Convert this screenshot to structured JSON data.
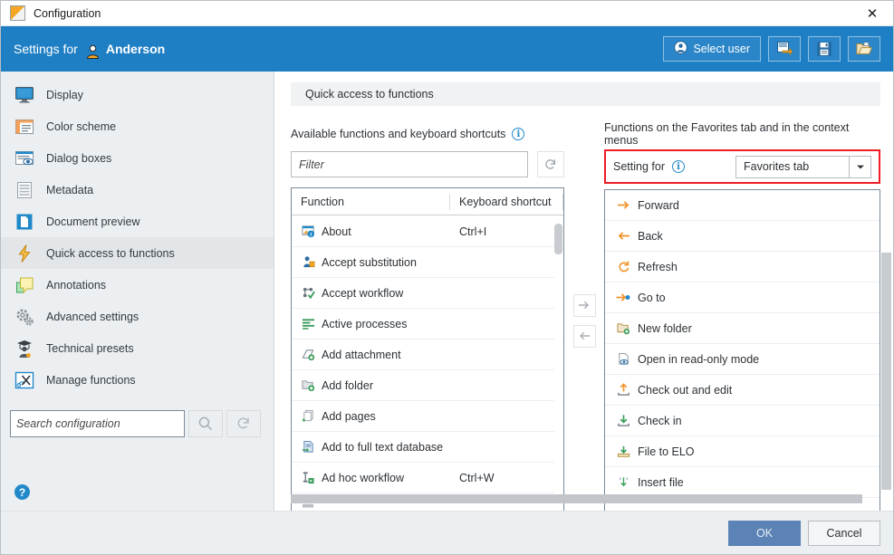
{
  "titlebar": {
    "title": "Configuration",
    "icon": "image-icon",
    "close": "✕"
  },
  "header": {
    "prefix": "Settings for",
    "user": "Anderson",
    "user_icon": "user-icon",
    "select_user_label": "Select user",
    "buttons": [
      {
        "name": "transfer-settings-button",
        "icon": "transfer-icon"
      },
      {
        "name": "save-settings-button",
        "icon": "save-icon"
      },
      {
        "name": "load-settings-button",
        "icon": "folder-open-icon"
      }
    ]
  },
  "sidebar": {
    "items": [
      {
        "label": "Display",
        "icon": "monitor-icon"
      },
      {
        "label": "Color scheme",
        "icon": "color-scheme-icon"
      },
      {
        "label": "Dialog boxes",
        "icon": "dialog-box-icon"
      },
      {
        "label": "Metadata",
        "icon": "metadata-icon"
      },
      {
        "label": "Document preview",
        "icon": "document-icon"
      },
      {
        "label": "Quick access to functions",
        "icon": "lightning-icon"
      },
      {
        "label": "Annotations",
        "icon": "sticky-note-icon"
      },
      {
        "label": "Advanced settings",
        "icon": "gears-icon"
      },
      {
        "label": "Technical presets",
        "icon": "graduate-icon"
      },
      {
        "label": "Manage functions",
        "icon": "manage-functions-icon"
      }
    ],
    "active_index": 5,
    "search": {
      "placeholder": "Search configuration",
      "value": "",
      "search_icon": "magnifier-icon",
      "reset_icon": "reset-icon"
    },
    "help_icon_label": "?"
  },
  "main": {
    "panel_title": "Quick access to functions",
    "left": {
      "heading": "Available functions and keyboard shortcuts",
      "info_icon": "info-icon",
      "filter": {
        "placeholder": "Filter",
        "value": "",
        "reset_icon": "reset-icon"
      },
      "columns": [
        "Function",
        "Keyboard shortcut"
      ],
      "rows": [
        {
          "function": "About",
          "shortcut": "Ctrl+I",
          "icon": "about-icon"
        },
        {
          "function": "Accept substitution",
          "shortcut": "",
          "icon": "substitution-icon"
        },
        {
          "function": "Accept workflow",
          "shortcut": "",
          "icon": "workflow-check-icon"
        },
        {
          "function": "Active processes",
          "shortcut": "",
          "icon": "processes-icon"
        },
        {
          "function": "Add attachment",
          "shortcut": "",
          "icon": "attachment-add-icon"
        },
        {
          "function": "Add folder",
          "shortcut": "",
          "icon": "folder-add-icon"
        },
        {
          "function": "Add pages",
          "shortcut": "",
          "icon": "pages-add-icon"
        },
        {
          "function": "Add to full text database",
          "shortcut": "",
          "icon": "fulltext-add-icon"
        },
        {
          "function": "Ad hoc workflow",
          "shortcut": "Ctrl+W",
          "icon": "adhoc-workflow-icon"
        }
      ]
    },
    "transfer": {
      "add_icon": "arrow-right-icon",
      "remove_icon": "arrow-left-icon"
    },
    "right": {
      "heading": "Functions on the Favorites tab and in the context menus",
      "setting_for_label": "Setting for",
      "info_icon": "info-icon",
      "setting_for_value": "Favorites tab",
      "dropdown_icon": "chevron-down-icon",
      "highlight_color": "#ee1c24",
      "rows": [
        {
          "label": "Forward",
          "icon": "arrow-forward-icon"
        },
        {
          "label": "Back",
          "icon": "arrow-back-icon"
        },
        {
          "label": "Refresh",
          "icon": "refresh-icon"
        },
        {
          "label": "Go to",
          "icon": "go-to-icon"
        },
        {
          "label": "New folder",
          "icon": "folder-new-icon"
        },
        {
          "label": "Open in read-only mode",
          "icon": "read-only-icon"
        },
        {
          "label": "Check out and edit",
          "icon": "check-out-icon"
        },
        {
          "label": "Check in",
          "icon": "check-in-icon"
        },
        {
          "label": "File to ELO",
          "icon": "file-to-elo-icon"
        },
        {
          "label": "Insert file",
          "icon": "insert-file-icon"
        }
      ]
    }
  },
  "footer": {
    "ok": "OK",
    "cancel": "Cancel"
  },
  "colors": {
    "header_blue": "#1f7fc4",
    "accent_red": "#ee1c24",
    "ok_button": "#5b83b5",
    "panel_bg": "#eceff1"
  }
}
